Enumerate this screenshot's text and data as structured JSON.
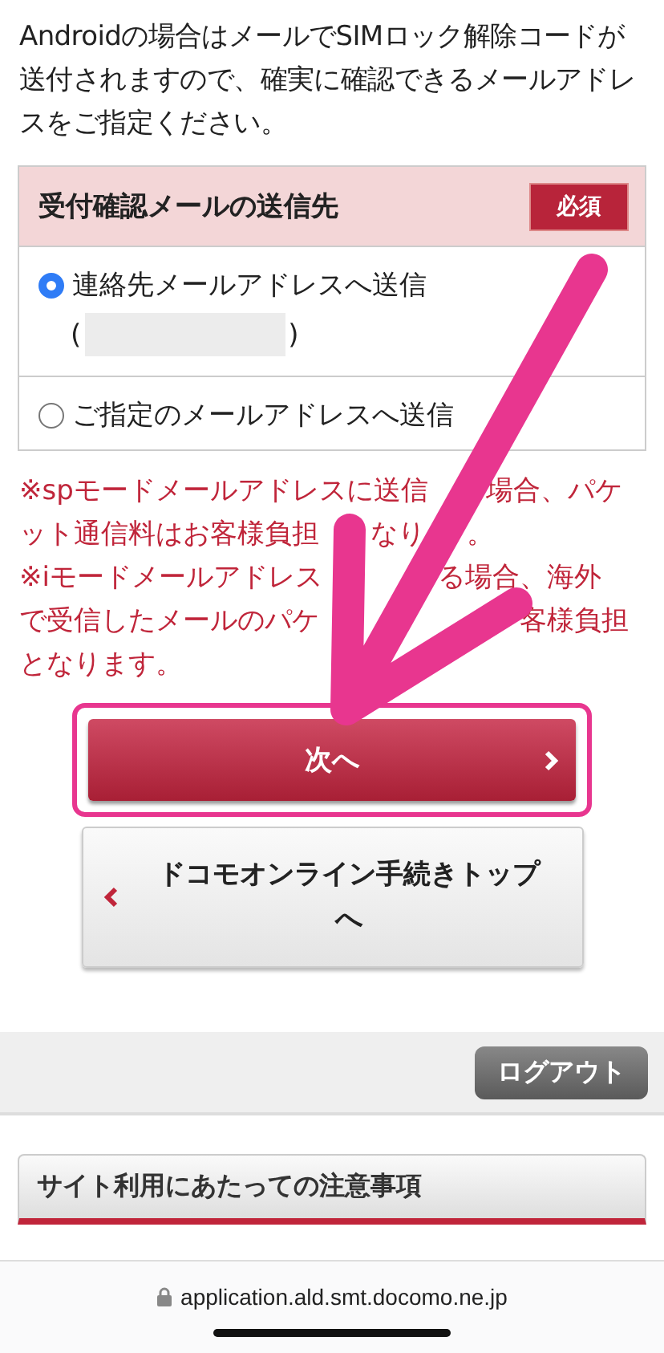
{
  "intro": "Androidの場合はメールでSIMロック解除コードが送付されますので、確実に確認できるメールアドレスをご指定ください。",
  "form": {
    "title": "受付確認メールの送信先",
    "required_badge": "必須",
    "options": [
      {
        "label": "連絡先メールアドレスへ送信",
        "selected": true,
        "kind": "with_address",
        "open_paren": "(",
        "close_paren": ")"
      },
      {
        "label": "ご指定のメールアドレスへ送信",
        "selected": false,
        "kind": "plain"
      }
    ]
  },
  "notes": [
    {
      "lines": [
        [
          "※spモードメールアドレスに送信",
          "場合、パケ"
        ],
        [
          "ット通信料はお客様負担",
          "なり",
          "。"
        ]
      ]
    },
    {
      "lines": [
        [
          "※iモードメールアドレス",
          "る場合、海外"
        ],
        [
          "で受信したメールのパケ",
          "客様負担"
        ],
        [
          "となります。"
        ]
      ]
    }
  ],
  "next_button": {
    "label": "次へ",
    "highlighted": true
  },
  "back_button": {
    "label": "ドコモオンライン手続きトップへ"
  },
  "logout_button": "ログアウト",
  "notice_link": "サイト利用にあたっての注意事項",
  "url": "application.ald.smt.docomo.ne.jp"
}
